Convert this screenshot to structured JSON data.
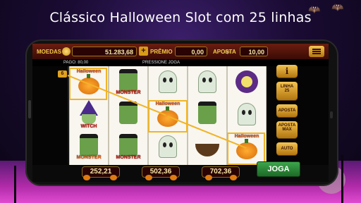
{
  "headline": "Clássico Halloween Slot com 25 linhas",
  "topbar": {
    "coins_label": "MOEDAS",
    "coins_value": "51.283,68",
    "plus_label": "+",
    "prize_label": "PRÊMIO",
    "prize_value": "0,00",
    "bet_label": "APOSTA",
    "bet_value": "10,00"
  },
  "info_row": {
    "paid_text": "PAGO: 80,00",
    "press_text": "PRESSIONE JOGA"
  },
  "reels": {
    "line_number": "6",
    "words": {
      "halloween": "Halloween",
      "monster": "MONSTER",
      "witch": "WITCH"
    }
  },
  "side_buttons": {
    "info": "i",
    "lines": [
      "LINHA",
      "25"
    ],
    "bet": "APOSTA",
    "bet_max": [
      "APOSTA",
      "MAX"
    ],
    "auto": "AUTO"
  },
  "bottom": {
    "win1": "252,21",
    "win2": "502,36",
    "win3": "702,36",
    "play": "JOGA"
  },
  "colors": {
    "accent": "#f0b428",
    "play": "#2f8f3a",
    "frame": "#6b1d10"
  }
}
